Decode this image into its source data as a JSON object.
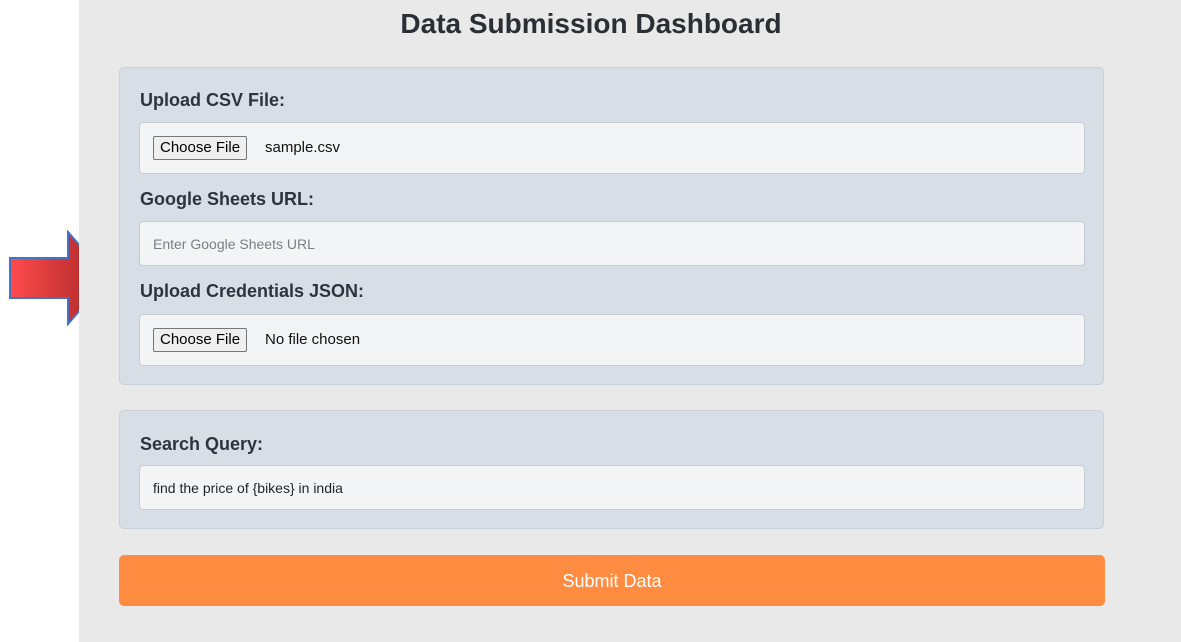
{
  "page": {
    "title": "Data Submission Dashboard"
  },
  "data_panel": {
    "csv": {
      "label": "Upload CSV File:",
      "button": "Choose File",
      "file_name": "sample.csv"
    },
    "sheets": {
      "label": "Google Sheets URL:",
      "placeholder": "Enter Google Sheets URL",
      "value": ""
    },
    "credentials": {
      "label": "Upload Credentials JSON:",
      "button": "Choose File",
      "file_name": "No file chosen"
    }
  },
  "query_panel": {
    "label": "Search Query:",
    "value": "find the price of {bikes} in india"
  },
  "submit_label": "Submit Data",
  "colors": {
    "background": "#e9e9e9",
    "panel": "#d8dee6",
    "submit": "#ff8c40",
    "arrow_fill_start": "#ff4b4b",
    "arrow_fill_end": "#a52626",
    "arrow_outline": "#4472c4"
  },
  "annotation": {
    "icon": "right-arrow-icon"
  }
}
